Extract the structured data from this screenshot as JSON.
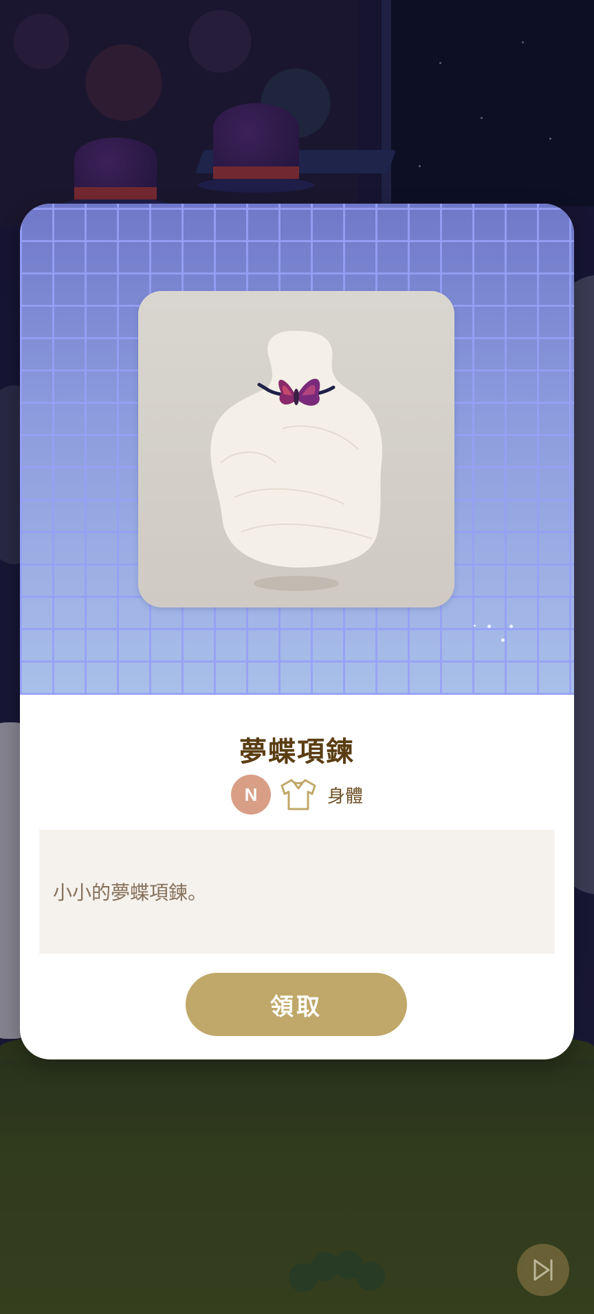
{
  "item": {
    "name": "夢蝶項鍊",
    "rarity": "N",
    "slot_icon": "shirt-icon",
    "slot_label": "身體",
    "description": "小小的夢蝶項鍊。"
  },
  "actions": {
    "claim_label": "領取",
    "skip_icon": "skip-forward-icon"
  },
  "colors": {
    "rarity_badge": "#d89f86",
    "claim_button": "#c0a86a",
    "title": "#5a3d12"
  }
}
